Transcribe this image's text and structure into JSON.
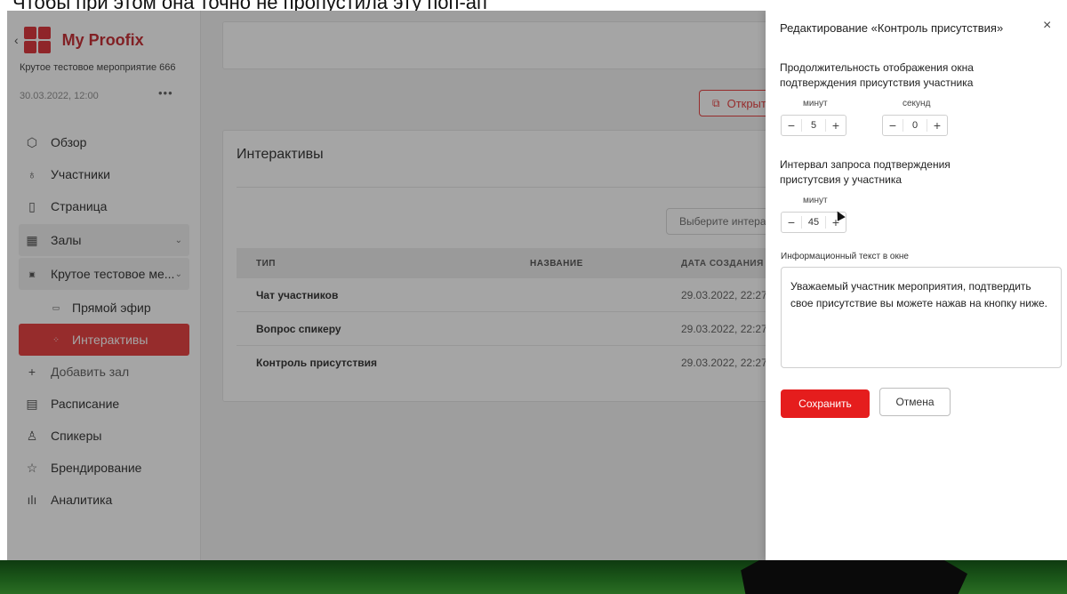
{
  "top_caption": "Чтобы при этом она точно не пропустила эту поп-ап",
  "sidebar": {
    "brand": "My Proofix",
    "event_name": "Крутое тестовое мероприятие 666",
    "event_date": "30.03.2022, 12:00",
    "more": "•••",
    "items": [
      {
        "label": "Обзор",
        "icon": "cube-icon"
      },
      {
        "label": "Участники",
        "icon": "users-icon"
      },
      {
        "label": "Страница",
        "icon": "page-icon"
      },
      {
        "label": "Залы",
        "icon": "film-icon"
      },
      {
        "label": "Крутое тестовое ме...",
        "icon": "hall-icon"
      },
      {
        "label": "Прямой эфир",
        "icon": "video-icon"
      },
      {
        "label": "Интерактивы",
        "icon": "grid-icon"
      },
      {
        "label": "Добавить зал",
        "icon": "plus-icon"
      },
      {
        "label": "Расписание",
        "icon": "calendar-icon"
      },
      {
        "label": "Спикеры",
        "icon": "user-icon"
      },
      {
        "label": "Брендирование",
        "icon": "star-icon"
      },
      {
        "label": "Аналитика",
        "icon": "bar-chart-icon"
      }
    ]
  },
  "main": {
    "open_button": "Открыть",
    "card_title": "Интерактивы",
    "select_placeholder": "Выберите интерактив",
    "table": {
      "headers": [
        "ТИП",
        "НАЗВАНИЕ",
        "ДАТА СОЗДАНИЯ"
      ],
      "rows": [
        {
          "type": "Чат участников",
          "name": "",
          "date": "29.03.2022, 22:27"
        },
        {
          "type": "Вопрос спикеру",
          "name": "",
          "date": "29.03.2022, 22:27"
        },
        {
          "type": "Контроль присутствия",
          "name": "",
          "date": "29.03.2022, 22:27"
        }
      ]
    }
  },
  "drawer": {
    "title": "Редактирование «Контроль присутствия»",
    "close": "×",
    "duration_label": "Продолжительность отображения окна подтверждения присутствия участника",
    "minutes_label": "минут",
    "seconds_label": "секунд",
    "duration_minutes": "5",
    "duration_seconds": "0",
    "interval_label": "Интервал запроса подтверждения пристутсвия у участника",
    "interval_minutes_label": "минут",
    "interval_minutes": "45",
    "info_label": "Информационный текст в окне",
    "info_text": "Уважаемый участник мероприятия, подтвердить свое присутствие вы можете нажав на кнопку ниже.",
    "save": "Сохранить",
    "cancel": "Отмена"
  },
  "colors": {
    "accent": "#e53030",
    "brand": "#c11b22",
    "overlay": "#282828"
  }
}
